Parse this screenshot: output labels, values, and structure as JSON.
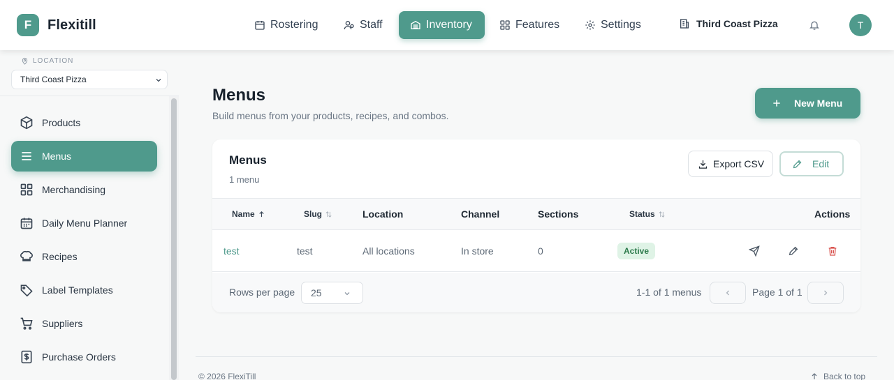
{
  "brand": {
    "mark": "F",
    "name": "Flexitill"
  },
  "nav": [
    {
      "label": "Rostering",
      "icon": "calendar-icon"
    },
    {
      "label": "Staff",
      "icon": "staff-icon"
    },
    {
      "label": "Inventory",
      "icon": "inventory-icon",
      "active": true
    },
    {
      "label": "Features",
      "icon": "grid-icon"
    },
    {
      "label": "Settings",
      "icon": "gear-icon"
    }
  ],
  "header": {
    "store": "Third Coast Pizza",
    "avatar": "T"
  },
  "sidebar": {
    "location_label": "LOCATION",
    "location_value": "Third Coast Pizza",
    "items": [
      {
        "label": "Products",
        "icon": "package-icon"
      },
      {
        "label": "Menus",
        "icon": "menu-icon",
        "active": true
      },
      {
        "label": "Merchandising",
        "icon": "grid-icon"
      },
      {
        "label": "Daily Menu Planner",
        "icon": "calendar-icon"
      },
      {
        "label": "Recipes",
        "icon": "chef-hat-icon"
      },
      {
        "label": "Label Templates",
        "icon": "tag-icon"
      },
      {
        "label": "Suppliers",
        "icon": "cart-icon"
      },
      {
        "label": "Purchase Orders",
        "icon": "receipt-icon"
      }
    ]
  },
  "page": {
    "title": "Menus",
    "subtitle": "Build menus from your products, recipes, and combos.",
    "new_button": "New Menu"
  },
  "card": {
    "title": "Menus",
    "count": "1 menu",
    "export_button": "Export CSV",
    "edit_button": "Edit"
  },
  "table": {
    "columns": [
      "Name",
      "Slug",
      "Location",
      "Channel",
      "Sections",
      "Status",
      "Actions"
    ],
    "rows": [
      {
        "name": "test",
        "slug": "test",
        "location": "All locations",
        "channel": "In store",
        "sections": "0",
        "status": "Active"
      }
    ]
  },
  "pagination": {
    "rows_label": "Rows per page",
    "rows_value": "25",
    "range": "1-1 of 1 menus",
    "page": "Page 1 of 1"
  },
  "footer": {
    "copyright": "© 2026 FlexiTill",
    "back_to_top": "Back to top"
  },
  "colors": {
    "accent": "#4f9a8c",
    "active_badge_bg": "#dff3e6",
    "active_badge_text": "#2c7a4b",
    "danger": "#d9534f"
  }
}
